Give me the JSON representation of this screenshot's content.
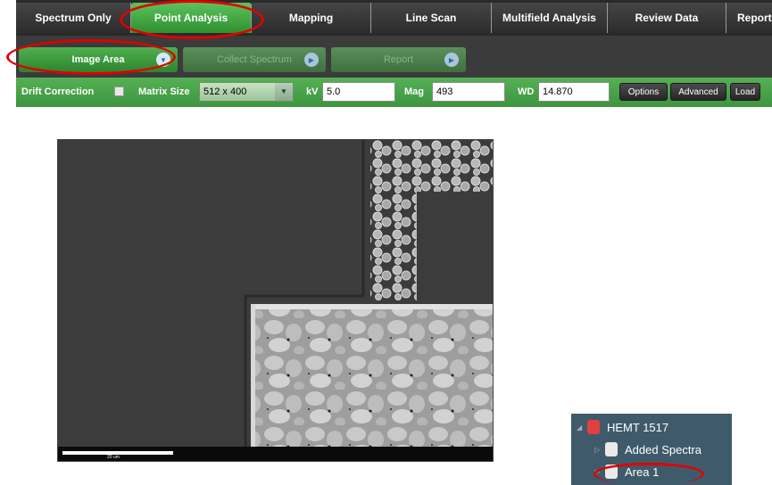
{
  "tabs": [
    "Spectrum Only",
    "Point Analysis",
    "Mapping",
    "Line Scan",
    "Multifield Analysis",
    "Review Data",
    "Report"
  ],
  "active_tab": "Point Analysis",
  "steps": [
    {
      "label": "Image Area",
      "icon": "chevron-down-icon",
      "enabled": true
    },
    {
      "label": "Collect Spectrum",
      "icon": "play-icon",
      "enabled": false
    },
    {
      "label": "Report",
      "icon": "play-icon",
      "enabled": false
    }
  ],
  "toolbar": {
    "drift_label": "Drift Correction",
    "drift_checked": false,
    "matrix_label": "Matrix Size",
    "matrix_value": "512 x 400",
    "kv_label": "kV",
    "kv_value": "5.0",
    "mag_label": "Mag",
    "mag_value": "493",
    "wd_label": "WD",
    "wd_value": "14.870",
    "options_label": "Options",
    "advanced_label": "Advanced",
    "load_label": "Load"
  },
  "sem_image": {
    "scale_label": "20 um"
  },
  "tree": {
    "root": "HEMT 1517",
    "children": [
      "Added Spectra",
      "Area 1"
    ]
  },
  "colors": {
    "active_green": "#3fa63f",
    "highlight_red": "#e00000",
    "tree_bg": "#3f5b6b"
  }
}
